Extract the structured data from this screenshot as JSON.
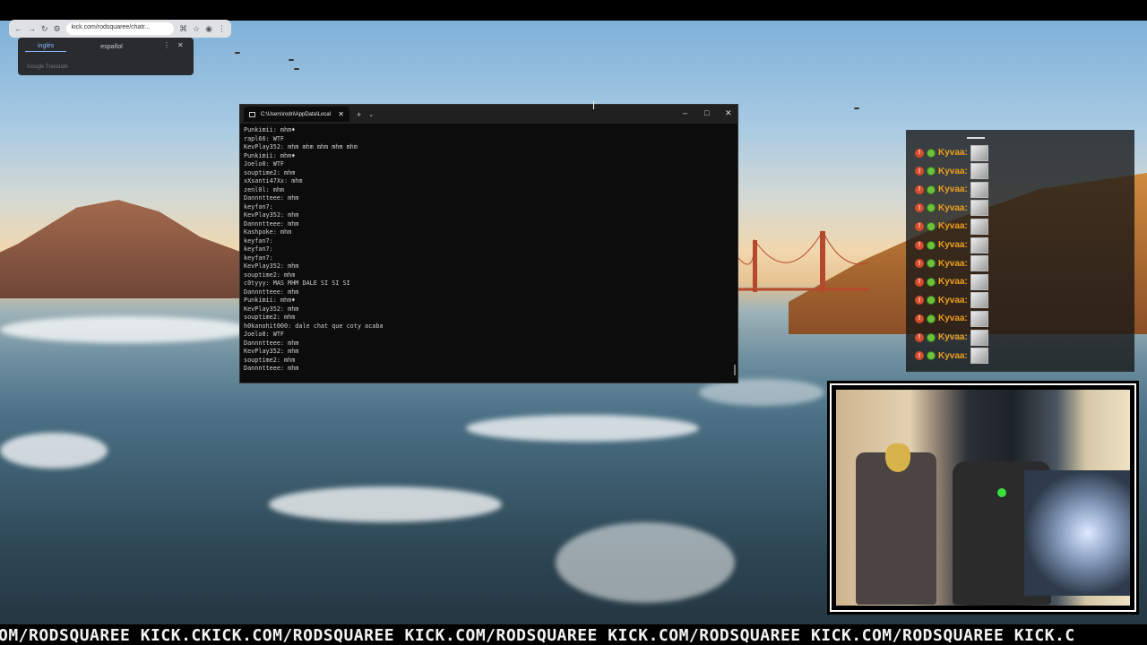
{
  "browser": {
    "url": "kick.com/rodsquaree/chatr...",
    "translate": {
      "tab_from": "inglés",
      "tab_to": "español",
      "brand": "Google Translate"
    }
  },
  "terminal": {
    "tab_title": "C:\\Users\\rodri\\AppData\\Local",
    "add_label": "+",
    "dropdown_label": "⌄",
    "min_label": "–",
    "max_label": "□",
    "close_label": "✕",
    "tab_close_label": "✕",
    "lines": [
      "Punkimii: mhm♦",
      "rapl66: WTF",
      "KevPlay352: mhm mhm mhm mhm mhm",
      "Punkimii: mhm♦",
      "Joelo0: WTF",
      "souptime2: mhm",
      "xXsanti47Xx: mhm",
      "zenl0l: mhm",
      "Dannntteee: mhm",
      "keyfan7:",
      "KevPlay352: mhm",
      "Dannntteee: mhm",
      "Kashpoke: mhm",
      "keyfan7:",
      "keyfan7:",
      "keyfan7:",
      "KevPlay352: mhm",
      "souptime2: mhm",
      "c0tyyy: MAS MHM DALE SI SI SI",
      "Dannntteee: mhm",
      "Punkimii: mhm♦",
      "KevPlay352: mhm",
      "souptime2: mhm",
      "h0kanohit000: dale chat que coty acaba",
      "Joelo0: WTF",
      "Dannntteee: mhm",
      "KevPlay352: mhm",
      "souptime2: mhm",
      "Dannntteee: mhm"
    ]
  },
  "chat_overlay": {
    "rows": [
      {
        "badge": "!",
        "name": "Kyvaa:"
      },
      {
        "badge": "!",
        "name": "Kyvaa:"
      },
      {
        "badge": "!",
        "name": "Kyvaa:"
      },
      {
        "badge": "!",
        "name": "Kyvaa:"
      },
      {
        "badge": "!",
        "name": "Kyvaa:"
      },
      {
        "badge": "!",
        "name": "Kyvaa:"
      },
      {
        "badge": "!",
        "name": "Kyvaa:"
      },
      {
        "badge": "!",
        "name": "Kyvaa:"
      },
      {
        "badge": "!",
        "name": "Kyvaa:"
      },
      {
        "badge": "!",
        "name": "Kyvaa:"
      },
      {
        "badge": "!",
        "name": "Kyvaa:"
      },
      {
        "badge": "!",
        "name": "Kyvaa:"
      }
    ]
  },
  "ticker": {
    "text": "OM/RODSQUAREE KICK.CKICK.COM/RODSQUAREE KICK.COM/RODSQUAREE KICK.COM/RODSQUAREE KICK.COM/RODSQUAREE KICK.C"
  },
  "colors": {
    "accent_chat_name": "#f0a020",
    "terminal_bg": "#0c0c0c",
    "translate_active": "#8ab4f8"
  },
  "icons": [
    "back-icon",
    "forward-icon",
    "reload-icon",
    "site-info-icon",
    "translate-icon",
    "star-icon",
    "profile-icon",
    "menu-icon",
    "terminal-icon"
  ]
}
